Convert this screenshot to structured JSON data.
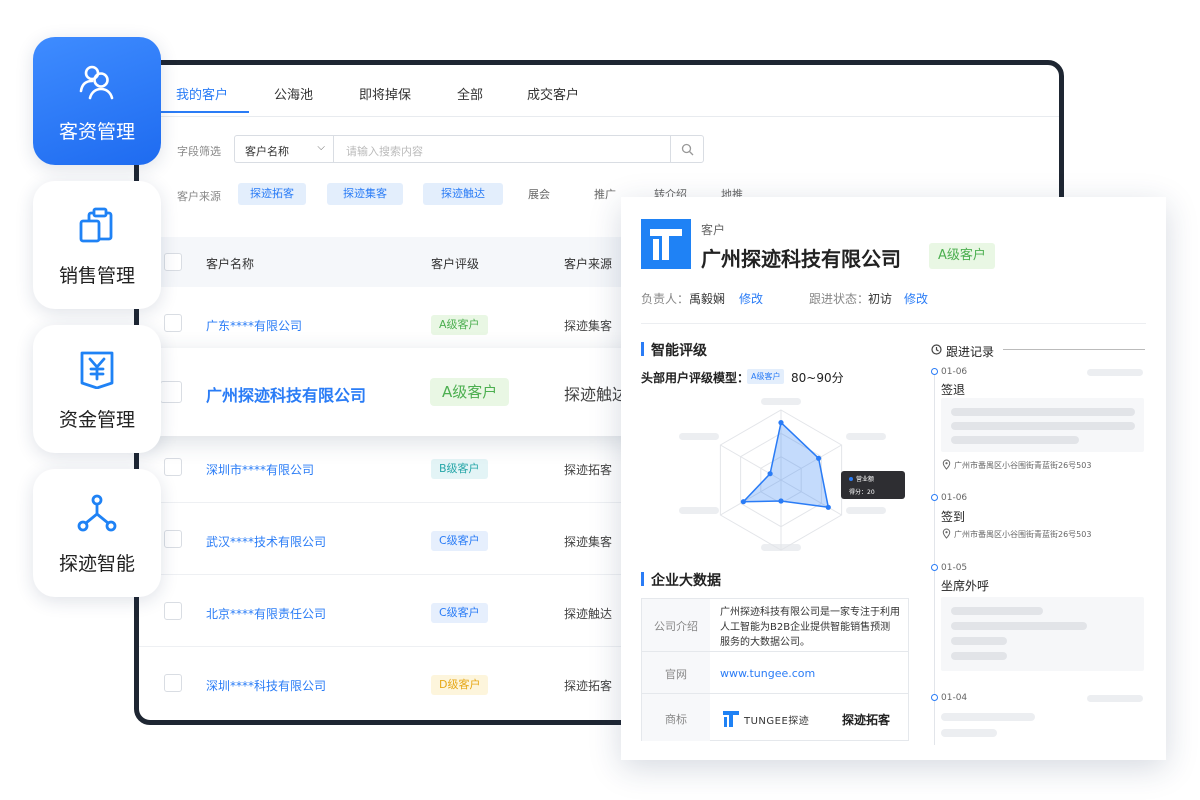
{
  "tabs": [
    {
      "label": "我的客户",
      "active": true
    },
    {
      "label": "公海池",
      "active": false
    },
    {
      "label": "即将掉保",
      "active": false
    },
    {
      "label": "全部",
      "active": false
    },
    {
      "label": "成交客户",
      "active": false
    }
  ],
  "filter": {
    "field_label": "字段筛选",
    "select_value": "客户名称",
    "search_placeholder": "请输入搜索内容",
    "source_label": "客户来源",
    "chips": [
      "探迹拓客",
      "探迹集客",
      "探迹触达"
    ],
    "plain_sources": [
      "展会",
      "推广",
      "转介绍",
      "地推"
    ]
  },
  "table": {
    "headers": [
      "客户名称",
      "客户评级",
      "客户来源"
    ],
    "rows": [
      {
        "name": "广东****有限公司",
        "grade": "A级客户",
        "grade_class": "a",
        "source": "探迹集客"
      },
      {
        "name": "深圳市****有限公司",
        "grade": "B级客户",
        "grade_class": "b",
        "source": "探迹拓客"
      },
      {
        "name": "武汉****技术有限公司",
        "grade": "C级客户",
        "grade_class": "c",
        "source": "探迹集客"
      },
      {
        "name": "北京****有限责任公司",
        "grade": "C级客户",
        "grade_class": "c",
        "source": "探迹触达"
      },
      {
        "name": "深圳****科技有限公司",
        "grade": "D级客户",
        "grade_class": "d",
        "source": "探迹拓客"
      }
    ],
    "highlight": {
      "name": "广州探迹科技有限公司",
      "grade": "A级客户",
      "source": "探迹触达"
    }
  },
  "nav": [
    {
      "label": "客资管理",
      "icon": "users-icon",
      "active": true
    },
    {
      "label": "销售管理",
      "icon": "clipboard-icon",
      "active": false
    },
    {
      "label": "资金管理",
      "icon": "yen-document-icon",
      "active": false
    },
    {
      "label": "探迹智能",
      "icon": "network-nodes-icon",
      "active": false
    }
  ],
  "detail": {
    "kicker": "客户",
    "company": "广州探迹科技有限公司",
    "grade": "A级客户",
    "owner_label": "负责人：",
    "owner": "禹毅娴",
    "edit": "修改",
    "status_label": "跟进状态：",
    "status": "初访",
    "rating_title": "智能评级",
    "model_label": "头部用户评级模型：",
    "model_badge": "A级客户",
    "model_range": "80~90分",
    "tooltip_series": "营业额",
    "tooltip_score": "得分：20",
    "radar_values": [
      0.82,
      0.62,
      0.78,
      0.3,
      0.62,
      0.18
    ],
    "bigdata_title": "企业大数据",
    "info": {
      "intro_label": "公司介绍",
      "intro": "广州探迹科技有限公司是一家专注于利用人工智能为B2B企业提供智能销售预测服务的大数据公司。",
      "site_label": "官网",
      "site": "www.tungee.com",
      "trademark_label": "商标",
      "trademark_wordmark": "TUNGEE探迹",
      "trademark_name": "探迹拓客"
    },
    "timeline_title": "跟进记录",
    "timeline": [
      {
        "date": "01-06",
        "action": "签退",
        "location": ""
      },
      {
        "date": "01-06",
        "action": "签到",
        "location": "广州市番禺区小谷围街青蓝街26号503"
      },
      {
        "date": "01-05",
        "action": "坐席外呼",
        "location": ""
      },
      {
        "date": "01-04",
        "action": "",
        "location": ""
      }
    ],
    "first_location": "广州市番禺区小谷围街青蓝街26号503"
  },
  "colors": {
    "accent": "#2a7cf6",
    "grade_a": "#4caf50",
    "frame": "#1e2632"
  }
}
